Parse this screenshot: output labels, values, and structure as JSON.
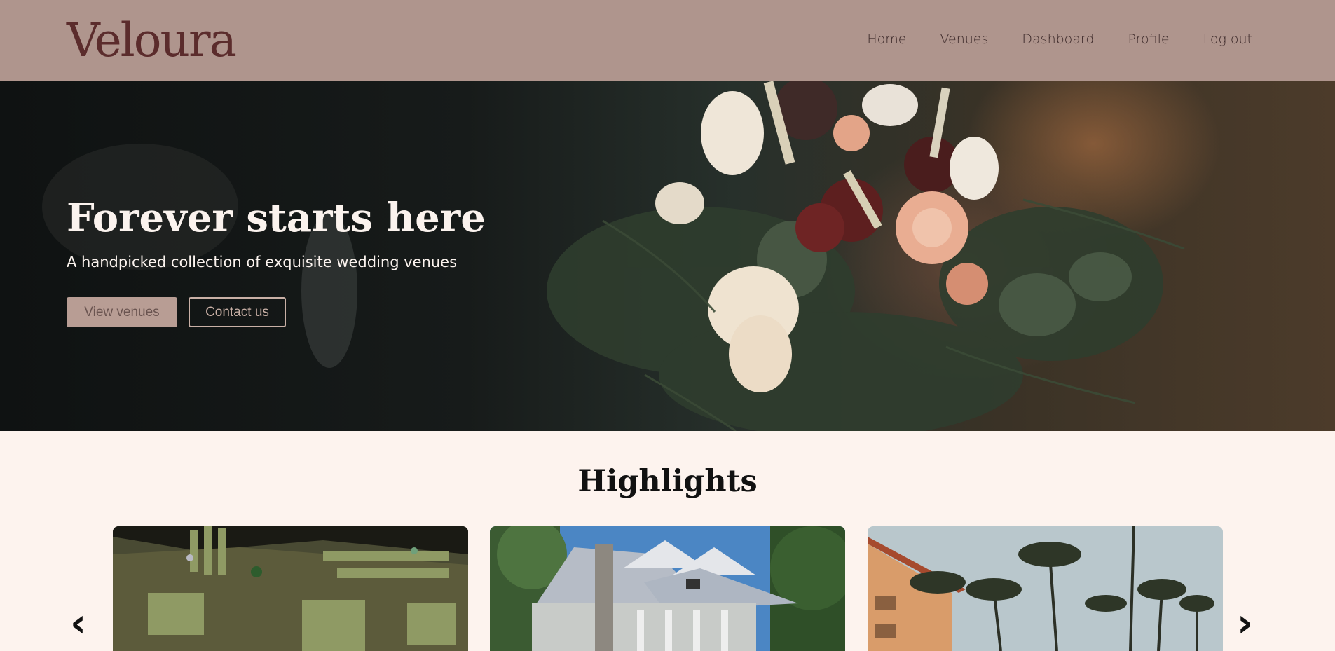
{
  "header": {
    "logo": "Veloura",
    "nav": [
      "Home",
      "Venues",
      "Dashboard",
      "Profile",
      "Log out"
    ]
  },
  "hero": {
    "title": "Forever starts here",
    "subtitle": "A handpicked collection of exquisite wedding venues",
    "primary_button": "View venues",
    "secondary_button": "Contact us"
  },
  "highlights": {
    "title": "Highlights",
    "cards": [
      "game-scene-image",
      "house-image",
      "palm-resort-image"
    ]
  },
  "icons": {
    "prev": "chevron-left-icon",
    "next": "chevron-right-icon"
  },
  "colors": {
    "header_bg": "#af958d",
    "logo": "#5b2c2c",
    "page_bg": "#fdf3ee",
    "primary_button": "#b89d94"
  }
}
